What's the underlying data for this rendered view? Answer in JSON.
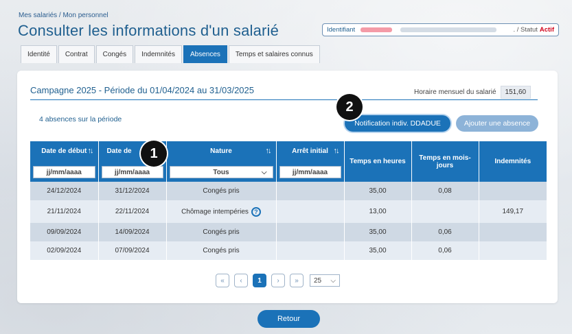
{
  "breadcrumb": "Mes salariés / Mon personnel",
  "title": "Consulter les informations d'un salarié",
  "identity": {
    "label": "Identifiant",
    "status_prefix": ". / Statut",
    "status_value": "Actif"
  },
  "tabs": [
    {
      "label": "Identité",
      "active": false
    },
    {
      "label": "Contrat",
      "active": false
    },
    {
      "label": "Congés",
      "active": false
    },
    {
      "label": "Indemnités",
      "active": false
    },
    {
      "label": "Absences",
      "active": true
    },
    {
      "label": "Temps et salaires connus",
      "active": false
    }
  ],
  "campaign": {
    "title": "Campagne 2025 - Période du 01/04/2024 au 31/03/2025",
    "horaire_label": "Horaire mensuel du salarié",
    "horaire_value": "151,60"
  },
  "absences_count": "4 absences sur la période",
  "buttons": {
    "notification": "Notification indiv. DDADUE",
    "add_absence": "Ajouter une absence",
    "retour": "Retour"
  },
  "table": {
    "headers": {
      "date_debut": "Date de début",
      "date_fin": "Date de",
      "nature": "Nature",
      "arret_initial": "Arrêt initial",
      "temps_heures": "Temps en heures",
      "temps_mois_jours": "Temps en mois-jours",
      "indemnites": "Indemnités"
    },
    "filters": {
      "date_debut_placeholder": "jj/mm/aaaa",
      "date_fin_placeholder": "jj/mm/aaaa",
      "nature_selected": "Tous",
      "arret_initial_placeholder": "jj/mm/aaaa"
    },
    "rows": [
      {
        "date_debut": "24/12/2024",
        "date_fin": "31/12/2024",
        "nature": "Congés pris",
        "arret_initial": "",
        "temps_heures": "35,00",
        "temps_mois_jours": "0,08",
        "indemnites": "",
        "help": false
      },
      {
        "date_debut": "21/11/2024",
        "date_fin": "22/11/2024",
        "nature": "Chômage intempéries",
        "arret_initial": "",
        "temps_heures": "13,00",
        "temps_mois_jours": "",
        "indemnites": "149,17",
        "help": true
      },
      {
        "date_debut": "09/09/2024",
        "date_fin": "14/09/2024",
        "nature": "Congés pris",
        "arret_initial": "",
        "temps_heures": "35,00",
        "temps_mois_jours": "0,06",
        "indemnites": "",
        "help": false
      },
      {
        "date_debut": "02/09/2024",
        "date_fin": "07/09/2024",
        "nature": "Congés pris",
        "arret_initial": "",
        "temps_heures": "35,00",
        "temps_mois_jours": "0,06",
        "indemnites": "",
        "help": false
      }
    ]
  },
  "pagination": {
    "first": "«",
    "prev": "‹",
    "current": "1",
    "next": "›",
    "last": "»",
    "page_size": "25"
  },
  "markers": [
    "1",
    "2"
  ]
}
